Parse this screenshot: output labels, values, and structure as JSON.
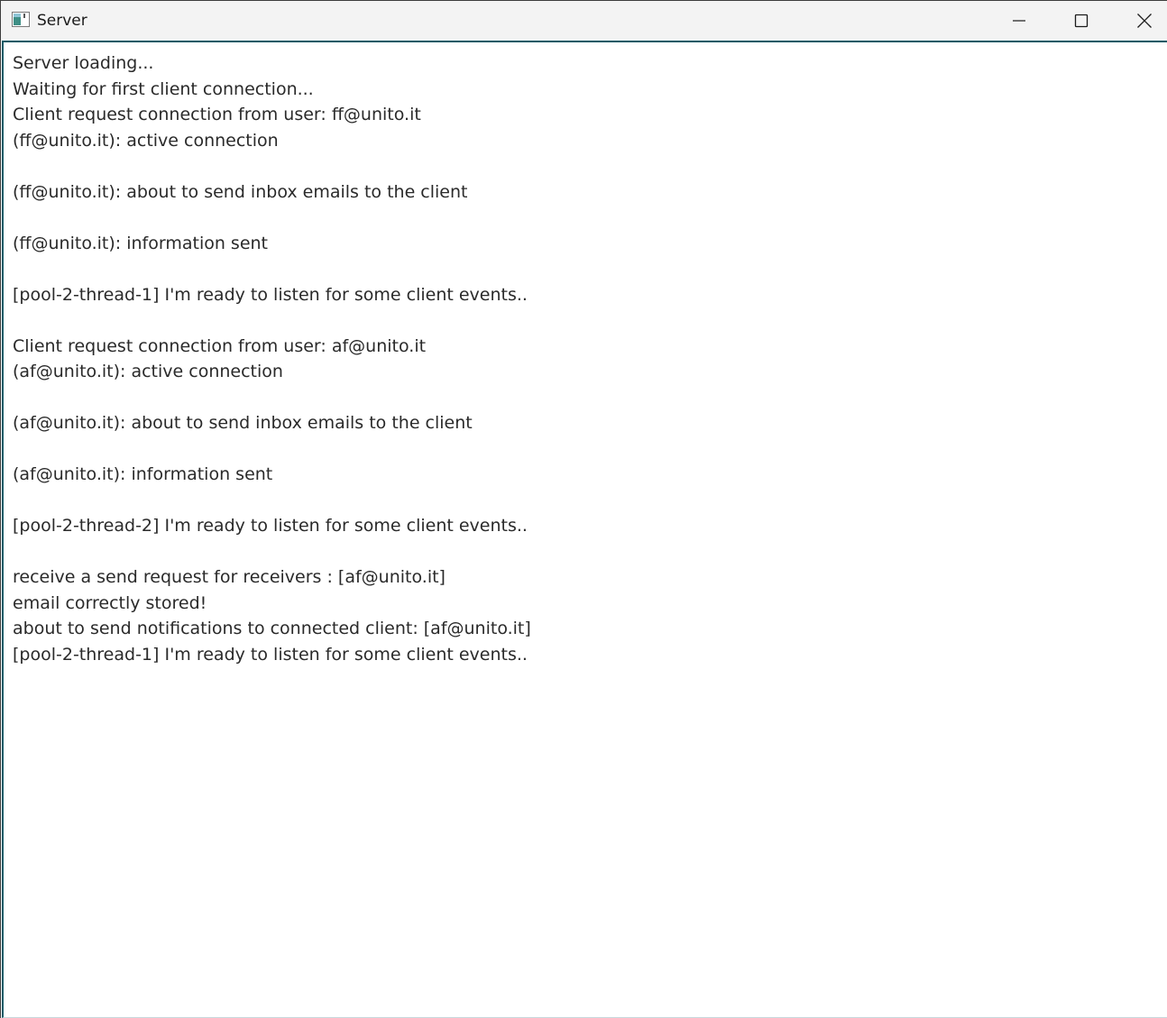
{
  "window": {
    "title": "Server",
    "icon": "java-app-icon"
  },
  "caption_buttons": {
    "minimize": "minimize-icon",
    "maximize": "maximize-icon",
    "close": "close-icon"
  },
  "log_lines": [
    "Server loading...",
    "Waiting for first client connection...",
    "Client request connection from user: ff@unito.it",
    "(ff@unito.it): active connection",
    "",
    "(ff@unito.it): about to send inbox emails to the client",
    "",
    "(ff@unito.it): information sent",
    "",
    "[pool-2-thread-1] I'm ready to listen for some client events..",
    "",
    "Client request connection from user: af@unito.it",
    "(af@unito.it): active connection",
    "",
    "(af@unito.it): about to send inbox emails to the client",
    "",
    "(af@unito.it): information sent",
    "",
    "[pool-2-thread-2] I'm ready to listen for some client events..",
    "",
    "receive a send request for receivers : [af@unito.it]",
    "email correctly stored!",
    "about to send notifications to connected client: [af@unito.it]",
    "[pool-2-thread-1] I'm ready to listen for some client events.."
  ],
  "colors": {
    "titlebar_bg": "#f3f3f3",
    "text": "#2a2a2a",
    "accent_border": "#0f5a66"
  }
}
